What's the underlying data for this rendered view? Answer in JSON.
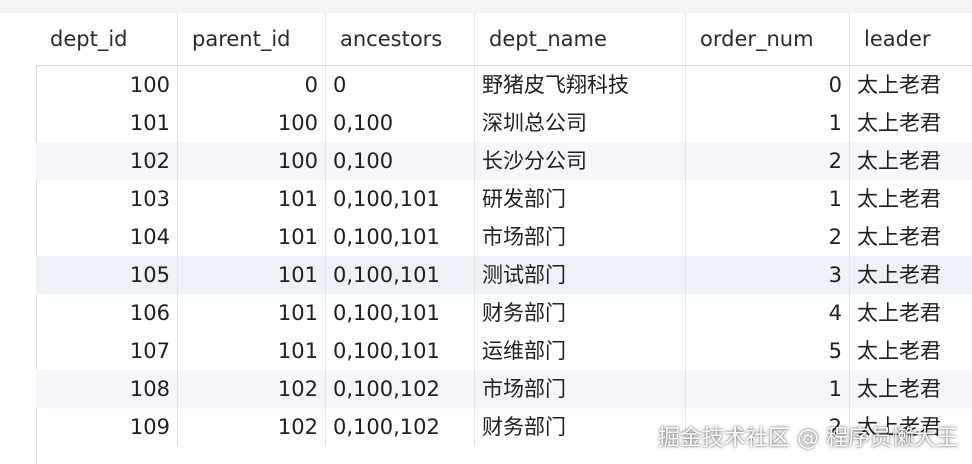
{
  "table": {
    "columns": [
      "dept_id",
      "parent_id",
      "ancestors",
      "dept_name",
      "order_num",
      "leader"
    ],
    "rows": [
      [
        "100",
        "0",
        "0",
        "野猪皮飞翔科技",
        "0",
        "太上老君"
      ],
      [
        "101",
        "100",
        "0,100",
        "深圳总公司",
        "1",
        "太上老君"
      ],
      [
        "102",
        "100",
        "0,100",
        "长沙分公司",
        "2",
        "太上老君"
      ],
      [
        "103",
        "101",
        "0,100,101",
        "研发部门",
        "1",
        "太上老君"
      ],
      [
        "104",
        "101",
        "0,100,101",
        "市场部门",
        "2",
        "太上老君"
      ],
      [
        "105",
        "101",
        "0,100,101",
        "测试部门",
        "3",
        "太上老君"
      ],
      [
        "106",
        "101",
        "0,100,101",
        "财务部门",
        "4",
        "太上老君"
      ],
      [
        "107",
        "101",
        "0,100,101",
        "运维部门",
        "5",
        "太上老君"
      ],
      [
        "108",
        "102",
        "0,100,102",
        "市场部门",
        "1",
        "太上老君"
      ],
      [
        "109",
        "102",
        "0,100,102",
        "财务部门",
        "2",
        "太上老君"
      ]
    ]
  },
  "watermark": "掘金技术社区 @ 程序员懒大王"
}
